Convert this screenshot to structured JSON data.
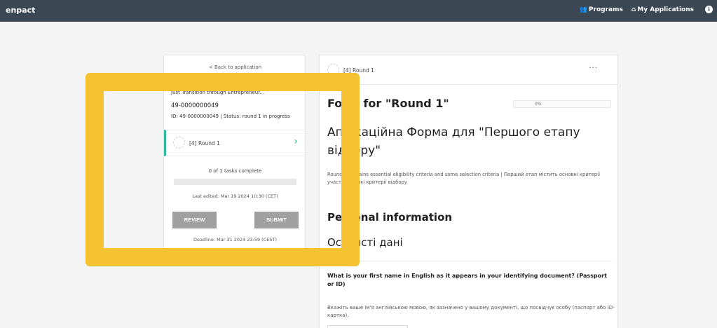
{
  "topbar": {
    "brand": "enpact",
    "nav": [
      {
        "icon": "👥",
        "icon_name": "users-icon",
        "label": "Programs"
      },
      {
        "icon": "⌂",
        "icon_name": "home-icon",
        "label": "My Applications"
      }
    ],
    "info_icon": "i"
  },
  "sidebar": {
    "back_link": "< Back to application",
    "program_name": "Just Transition through Entrepreneur...",
    "application_number": "49-0000000049",
    "application_id_status": "ID: 49-0000000049 | Status: round 1 in progress",
    "round": {
      "label": "[4] Round 1",
      "chevron": "›"
    },
    "tasks": "0 of 1 tasks complete",
    "progress_pct": 0,
    "last_edited": "Last edited: Mar 19 2024 10:30 (CET)",
    "review_label": "REVIEW",
    "submit_label": "SUBMIT",
    "deadline": "Deadline: Mar 31 2024 23:59 (CEST)"
  },
  "form": {
    "header_round": "[4]  Round 1",
    "more": "···",
    "title": "Form for \"Round 1\"",
    "percent_label": "0%",
    "title_uk": "Аплікаційна Форма для \"Першого етапу відбору\"",
    "description": "Round 1 contains essential eligibility criteria and some selection criteria | Перший етап містить основні критерії участі та деякі критерії відбору",
    "section_en": "Personal information",
    "section_uk": "Особисті дані",
    "question": "What is your first name in English as it appears in your identifying document? (Passport or ID)",
    "hint_uk": "Вкажіть ваше ім'я англійською мовою, як зазначено у вашому документі, що посвідчує особу (паспорт або ID-картка).",
    "answer_value": ""
  },
  "colors": {
    "accent": "#2eb89a",
    "highlight": "#f4c232",
    "topbar": "#3b4753",
    "button": "#a0a0a0"
  }
}
